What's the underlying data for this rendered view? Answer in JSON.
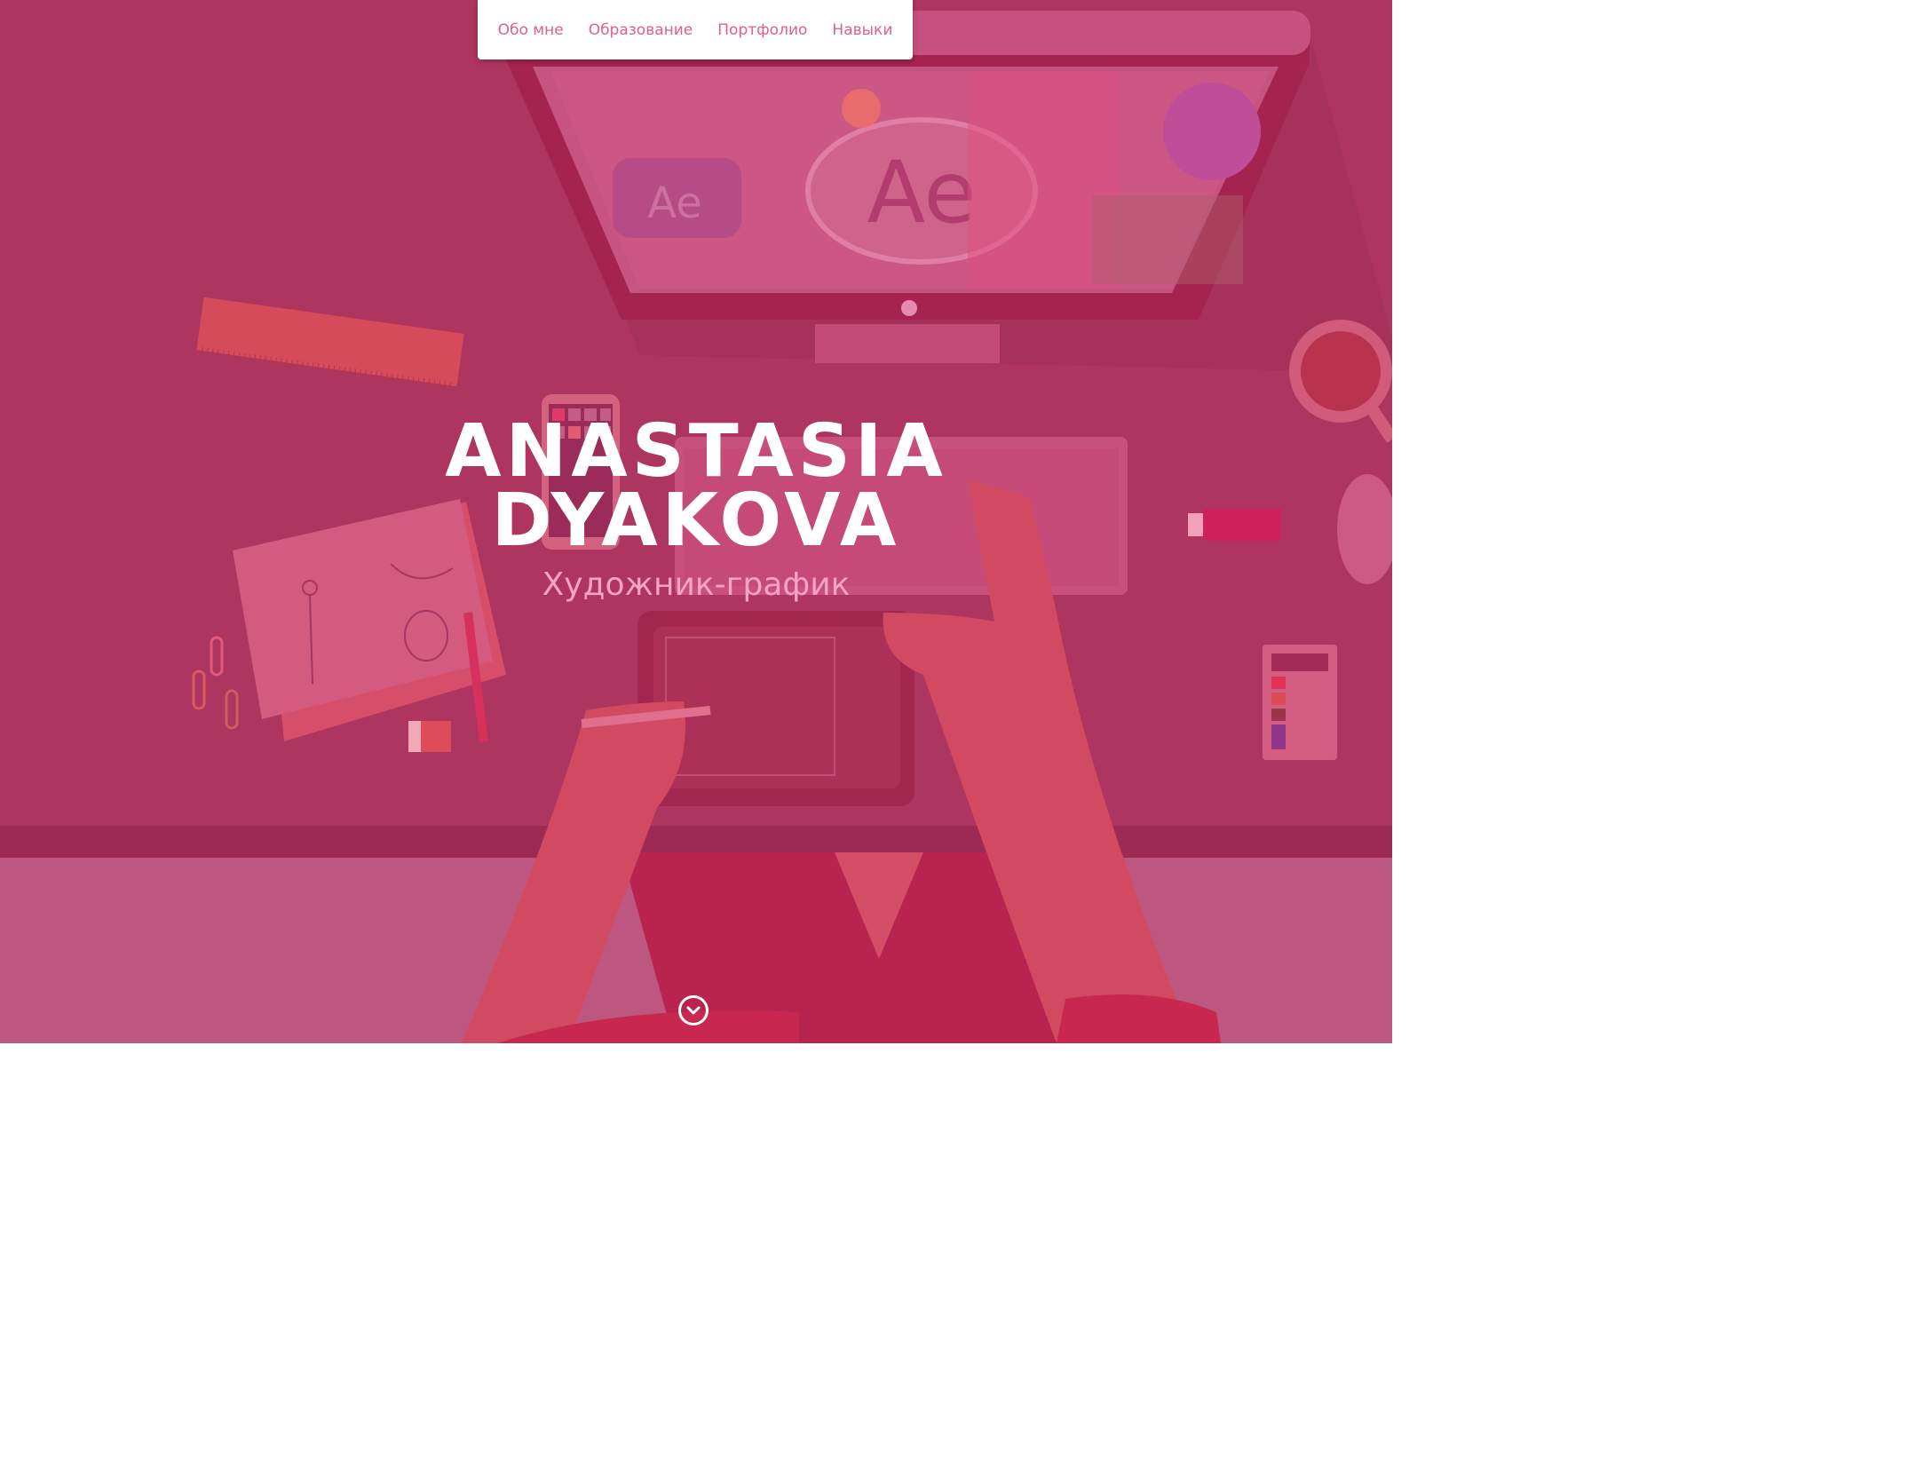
{
  "nav": {
    "items": [
      {
        "label": "Обо мне"
      },
      {
        "label": "Образование"
      },
      {
        "label": "Портфолио"
      },
      {
        "label": "Навыки"
      }
    ]
  },
  "hero": {
    "name_line1": "ANASTASIA",
    "name_line2": "DYAKOVA",
    "subtitle": "Художник-график",
    "screen_logo": "Ae",
    "scroll_icon": "chevron-down-icon"
  },
  "colors": {
    "hero_overlay": "#b0365f",
    "nav_link": "#e0608c",
    "subtitle": "#f7a3c6"
  }
}
